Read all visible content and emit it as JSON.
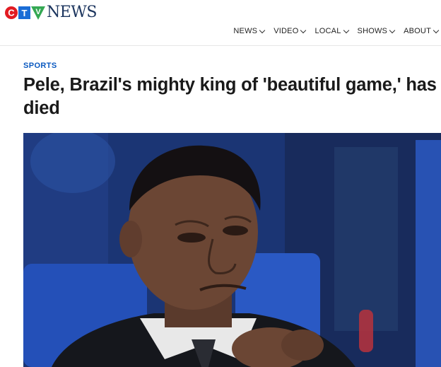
{
  "brand": {
    "name": "CTV News",
    "logo_letters": [
      "C",
      "T",
      "V"
    ],
    "logo_word": "NEWS",
    "colors": {
      "red": "#e21b22",
      "blue": "#1a6dd6",
      "green": "#34a853",
      "navy": "#1c355e"
    }
  },
  "nav": {
    "items": [
      {
        "label": "NEWS"
      },
      {
        "label": "VIDEO"
      },
      {
        "label": "LOCAL"
      },
      {
        "label": "SHOWS"
      },
      {
        "label": "ABOUT"
      }
    ]
  },
  "article": {
    "section": "SPORTS",
    "headline": "Pele, Brazil's mighty king of 'beautiful game,' has died",
    "accent_color": "#0a59c0"
  }
}
